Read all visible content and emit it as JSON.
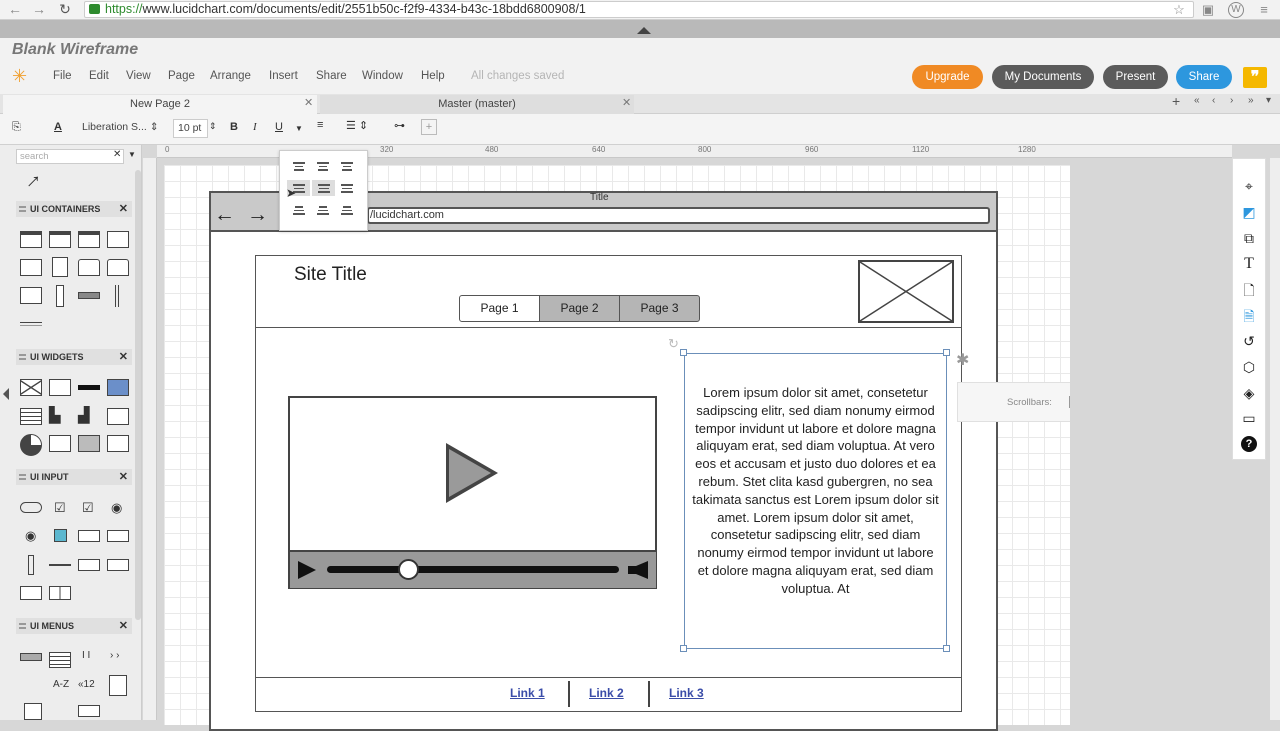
{
  "browser": {
    "url_scheme": "https://",
    "url_rest": "www.lucidchart.com/documents/edit/2551b50c-f2f9-4334-b43c-18bdd6800908/1"
  },
  "app": {
    "doc_title": "Blank Wireframe",
    "menus": [
      "File",
      "Edit",
      "View",
      "Page",
      "Arrange",
      "Insert",
      "Share",
      "Window",
      "Help"
    ],
    "save_status": "All changes saved",
    "buttons": {
      "upgrade": "Upgrade",
      "my_documents": "My Documents",
      "present": "Present",
      "share": "Share"
    },
    "colors": {
      "upgrade": "#f08a24",
      "dark": "#5b5b5b",
      "share": "#2d97de",
      "quote": "#f5b800"
    }
  },
  "tabs": [
    {
      "label": "New Page 2"
    },
    {
      "label": "Master (master)"
    }
  ],
  "toolbar": {
    "font": "Liberation S...",
    "size": "10 pt",
    "bold": "B",
    "italic": "I",
    "underline": "U"
  },
  "left": {
    "search_placeholder": "search",
    "sections": [
      "UI CONTAINERS",
      "UI WIDGETS",
      "UI INPUT",
      "UI MENUS"
    ],
    "misc": {
      "az": "A-Z",
      "k12": "«12",
      "ii": "I I",
      "chev": "› ›"
    }
  },
  "ruler": {
    "h": [
      "0",
      "320",
      "480",
      "640",
      "800",
      "960",
      "1120",
      "1280"
    ]
  },
  "wireframe": {
    "title": "Title",
    "url": "/lucidchart.com",
    "site_title": "Site Title",
    "pages": [
      "Page 1",
      "Page 2",
      "Page 3"
    ],
    "lorem": "Lorem ipsum dolor sit amet, consetetur sadipscing elitr, sed diam nonumy eirmod tempor invidunt ut labore et dolore magna aliquyam erat, sed diam voluptua. At vero eos et accusam et justo duo dolores et ea rebum. Stet clita kasd gubergren, no sea takimata sanctus est Lorem ipsum dolor sit amet. Lorem ipsum dolor sit amet, consetetur sadipscing elitr, sed diam nonumy eirmod tempor invidunt ut labore et dolore magna aliquyam erat, sed diam voluptua. At",
    "links": [
      "Link 1",
      "Link 2",
      "Link 3"
    ]
  },
  "popup": {
    "scrollbars": "Scrollbars:"
  }
}
